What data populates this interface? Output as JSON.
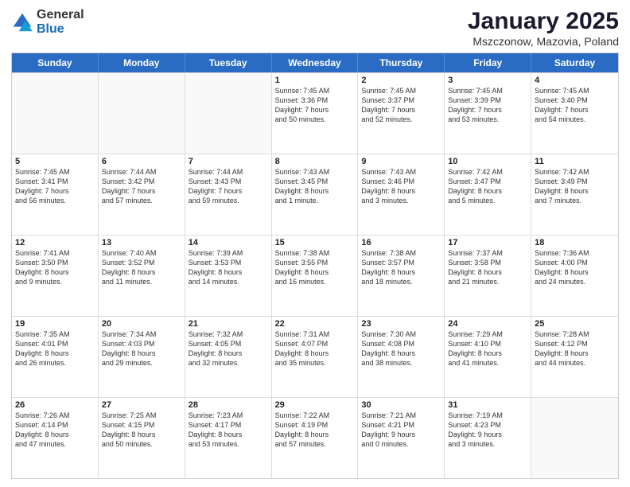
{
  "header": {
    "logo_general": "General",
    "logo_blue": "Blue",
    "title": "January 2025",
    "subtitle": "Mszczonow, Mazovia, Poland"
  },
  "calendar": {
    "days_of_week": [
      "Sunday",
      "Monday",
      "Tuesday",
      "Wednesday",
      "Thursday",
      "Friday",
      "Saturday"
    ],
    "rows": [
      [
        {
          "day": "",
          "text": ""
        },
        {
          "day": "",
          "text": ""
        },
        {
          "day": "",
          "text": ""
        },
        {
          "day": "1",
          "text": "Sunrise: 7:45 AM\nSunset: 3:36 PM\nDaylight: 7 hours\nand 50 minutes."
        },
        {
          "day": "2",
          "text": "Sunrise: 7:45 AM\nSunset: 3:37 PM\nDaylight: 7 hours\nand 52 minutes."
        },
        {
          "day": "3",
          "text": "Sunrise: 7:45 AM\nSunset: 3:39 PM\nDaylight: 7 hours\nand 53 minutes."
        },
        {
          "day": "4",
          "text": "Sunrise: 7:45 AM\nSunset: 3:40 PM\nDaylight: 7 hours\nand 54 minutes."
        }
      ],
      [
        {
          "day": "5",
          "text": "Sunrise: 7:45 AM\nSunset: 3:41 PM\nDaylight: 7 hours\nand 56 minutes."
        },
        {
          "day": "6",
          "text": "Sunrise: 7:44 AM\nSunset: 3:42 PM\nDaylight: 7 hours\nand 57 minutes."
        },
        {
          "day": "7",
          "text": "Sunrise: 7:44 AM\nSunset: 3:43 PM\nDaylight: 7 hours\nand 59 minutes."
        },
        {
          "day": "8",
          "text": "Sunrise: 7:43 AM\nSunset: 3:45 PM\nDaylight: 8 hours\nand 1 minute."
        },
        {
          "day": "9",
          "text": "Sunrise: 7:43 AM\nSunset: 3:46 PM\nDaylight: 8 hours\nand 3 minutes."
        },
        {
          "day": "10",
          "text": "Sunrise: 7:42 AM\nSunset: 3:47 PM\nDaylight: 8 hours\nand 5 minutes."
        },
        {
          "day": "11",
          "text": "Sunrise: 7:42 AM\nSunset: 3:49 PM\nDaylight: 8 hours\nand 7 minutes."
        }
      ],
      [
        {
          "day": "12",
          "text": "Sunrise: 7:41 AM\nSunset: 3:50 PM\nDaylight: 8 hours\nand 9 minutes."
        },
        {
          "day": "13",
          "text": "Sunrise: 7:40 AM\nSunset: 3:52 PM\nDaylight: 8 hours\nand 11 minutes."
        },
        {
          "day": "14",
          "text": "Sunrise: 7:39 AM\nSunset: 3:53 PM\nDaylight: 8 hours\nand 14 minutes."
        },
        {
          "day": "15",
          "text": "Sunrise: 7:38 AM\nSunset: 3:55 PM\nDaylight: 8 hours\nand 16 minutes."
        },
        {
          "day": "16",
          "text": "Sunrise: 7:38 AM\nSunset: 3:57 PM\nDaylight: 8 hours\nand 18 minutes."
        },
        {
          "day": "17",
          "text": "Sunrise: 7:37 AM\nSunset: 3:58 PM\nDaylight: 8 hours\nand 21 minutes."
        },
        {
          "day": "18",
          "text": "Sunrise: 7:36 AM\nSunset: 4:00 PM\nDaylight: 8 hours\nand 24 minutes."
        }
      ],
      [
        {
          "day": "19",
          "text": "Sunrise: 7:35 AM\nSunset: 4:01 PM\nDaylight: 8 hours\nand 26 minutes."
        },
        {
          "day": "20",
          "text": "Sunrise: 7:34 AM\nSunset: 4:03 PM\nDaylight: 8 hours\nand 29 minutes."
        },
        {
          "day": "21",
          "text": "Sunrise: 7:32 AM\nSunset: 4:05 PM\nDaylight: 8 hours\nand 32 minutes."
        },
        {
          "day": "22",
          "text": "Sunrise: 7:31 AM\nSunset: 4:07 PM\nDaylight: 8 hours\nand 35 minutes."
        },
        {
          "day": "23",
          "text": "Sunrise: 7:30 AM\nSunset: 4:08 PM\nDaylight: 8 hours\nand 38 minutes."
        },
        {
          "day": "24",
          "text": "Sunrise: 7:29 AM\nSunset: 4:10 PM\nDaylight: 8 hours\nand 41 minutes."
        },
        {
          "day": "25",
          "text": "Sunrise: 7:28 AM\nSunset: 4:12 PM\nDaylight: 8 hours\nand 44 minutes."
        }
      ],
      [
        {
          "day": "26",
          "text": "Sunrise: 7:26 AM\nSunset: 4:14 PM\nDaylight: 8 hours\nand 47 minutes."
        },
        {
          "day": "27",
          "text": "Sunrise: 7:25 AM\nSunset: 4:15 PM\nDaylight: 8 hours\nand 50 minutes."
        },
        {
          "day": "28",
          "text": "Sunrise: 7:23 AM\nSunset: 4:17 PM\nDaylight: 8 hours\nand 53 minutes."
        },
        {
          "day": "29",
          "text": "Sunrise: 7:22 AM\nSunset: 4:19 PM\nDaylight: 8 hours\nand 57 minutes."
        },
        {
          "day": "30",
          "text": "Sunrise: 7:21 AM\nSunset: 4:21 PM\nDaylight: 9 hours\nand 0 minutes."
        },
        {
          "day": "31",
          "text": "Sunrise: 7:19 AM\nSunset: 4:23 PM\nDaylight: 9 hours\nand 3 minutes."
        },
        {
          "day": "",
          "text": ""
        }
      ]
    ]
  }
}
